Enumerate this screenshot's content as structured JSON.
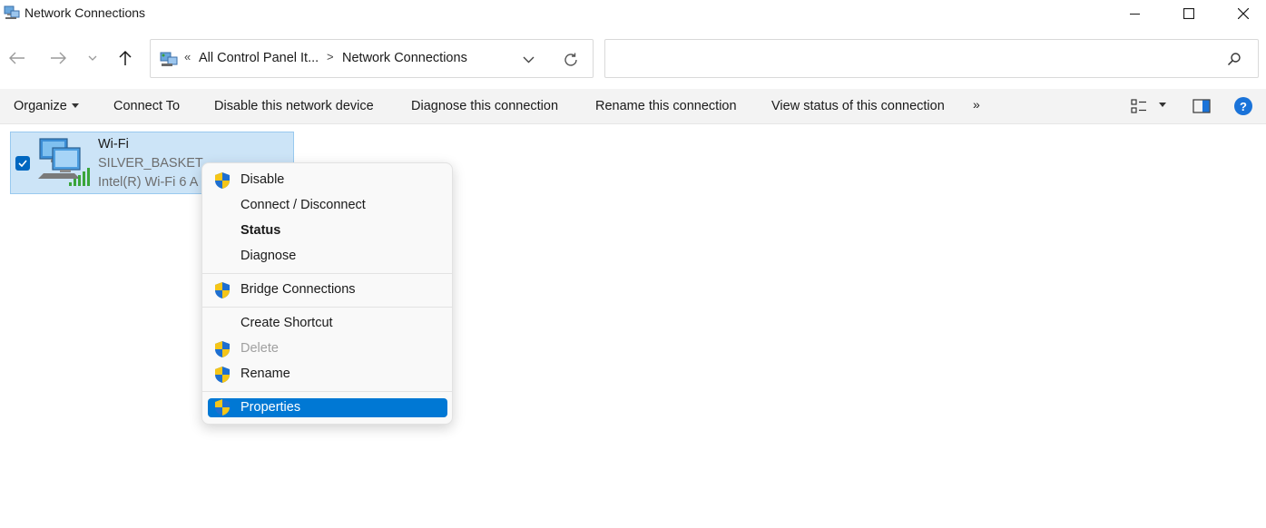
{
  "window": {
    "title": "Network Connections",
    "icon": "network-connections-icon"
  },
  "nav": {
    "back_icon": "arrow-left-icon",
    "forward_icon": "arrow-right-icon",
    "recent_icon": "chevron-down-icon",
    "up_icon": "arrow-up-icon"
  },
  "address": {
    "overflow": "«",
    "crumbs": [
      "All Control Panel It...",
      "Network Connections"
    ],
    "separator": ">"
  },
  "search": {
    "value": "",
    "placeholder": ""
  },
  "toolbar": {
    "organize": "Organize",
    "connect_to": "Connect To",
    "disable_device": "Disable this network device",
    "diagnose": "Diagnose this connection",
    "rename": "Rename this connection",
    "view_status": "View status of this connection",
    "more": "»",
    "help": "?"
  },
  "connection": {
    "name": "Wi-Fi",
    "network": "SILVER_BASKET",
    "adapter": "Intel(R) Wi-Fi 6 A",
    "selected": true
  },
  "context_menu": {
    "items": [
      {
        "label": "Disable",
        "shield": true
      },
      {
        "label": "Connect / Disconnect",
        "shield": false
      },
      {
        "label": "Status",
        "shield": false,
        "bold": true
      },
      {
        "label": "Diagnose",
        "shield": false
      },
      {
        "label": "Bridge Connections",
        "shield": true
      },
      {
        "label": "Create Shortcut",
        "shield": false
      },
      {
        "label": "Delete",
        "shield": true,
        "disabled": true
      },
      {
        "label": "Rename",
        "shield": true
      },
      {
        "label": "Properties",
        "shield": true,
        "highlighted": true
      }
    ]
  },
  "colors": {
    "selection_bg": "#cce4f7",
    "highlight": "#0078d4",
    "toolbar_bg": "#f3f3f3"
  }
}
